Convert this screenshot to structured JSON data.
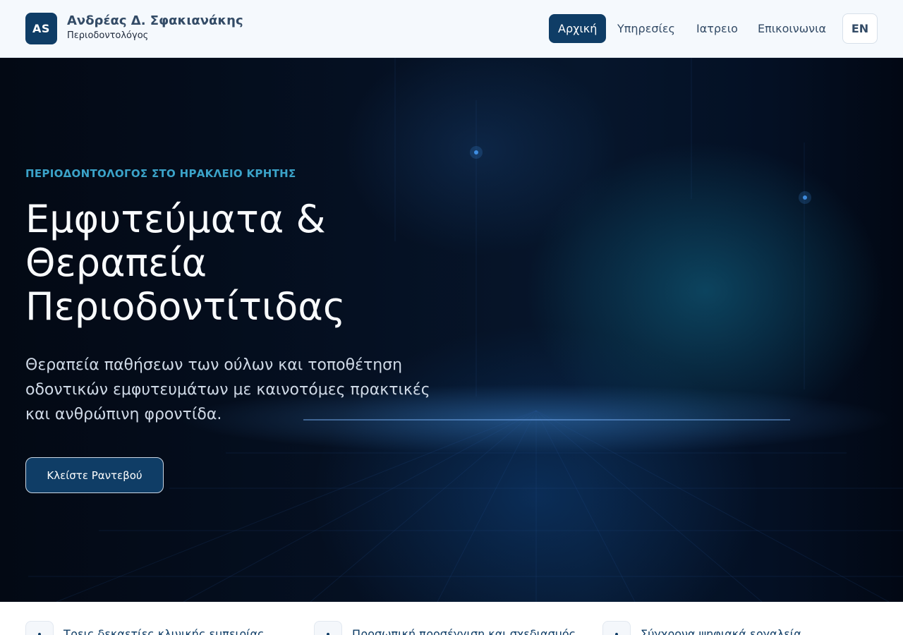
{
  "header": {
    "logo_initials": "AS",
    "name": "Ανδρέας Δ. Σφακιανάκης",
    "subtitle": "Περιοδοντολόγος",
    "nav": [
      {
        "label": "Αρχική",
        "active": true
      },
      {
        "label": "Υπηρεσίες",
        "active": false
      },
      {
        "label": "Ιατρειο",
        "active": false
      },
      {
        "label": "Επικοινωνια",
        "active": false
      }
    ],
    "language_button": "EN"
  },
  "hero": {
    "eyebrow": "ΠΕΡΙΟΔΟΝΤΟΛΟΓΟΣ ΣΤΟ ΗΡΑΚΛΕΙΟ ΚΡΗΤΗΣ",
    "title": "Εμφυτεύματα & Θεραπεία Περιοδοντίτιδας",
    "description": "Θεραπεία παθήσεων των ούλων και τοποθέτηση οδοντικών εμφυτευμάτων με καινοτόμες πρακτικές και ανθρώπινη φροντίδα.",
    "cta_label": "Κλείστε Ραντεβού"
  },
  "features": [
    {
      "icon": "check-icon",
      "glyph": "•",
      "label": "Τρεις δεκαετίες κλινικής εμπειρίας"
    },
    {
      "icon": "user-icon",
      "glyph": "•",
      "label": "Προσωπική προσέγγιση και σχεδιασμός"
    },
    {
      "icon": "monitor-icon",
      "glyph": "•",
      "label": "Σύγχρονα ψηφιακά εργαλεία"
    }
  ],
  "colors": {
    "primary": "#0f3d66",
    "accent": "#3ba3c9",
    "header_bg": "#f5f9fd"
  }
}
